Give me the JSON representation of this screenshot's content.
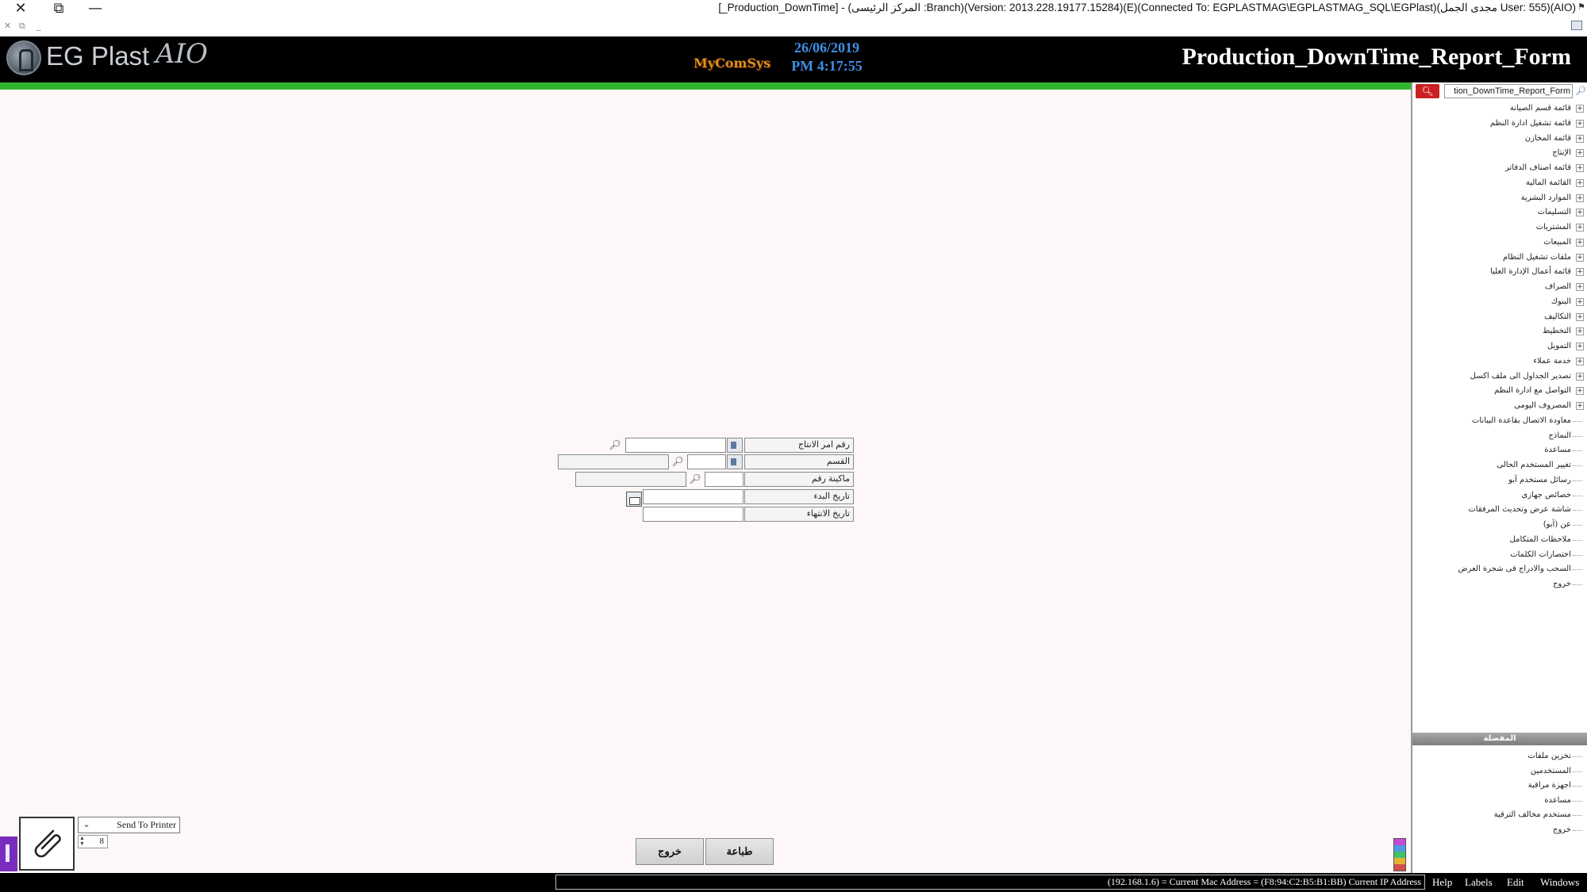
{
  "window": {
    "title": "[_Production_DownTime] - (المركز الرئيسى :Branch)(Version: 2013.228.19177.15284)(E)(Connected To: EGPLASTMAG\\EGPLASTMAG_SQL\\EGPlast)(مجدى الجمل User: 555)(AIO)",
    "close_glyph": "✕",
    "restore_glyph": "⧉",
    "minimize_glyph": "—"
  },
  "header": {
    "logo_text": "EG Plast",
    "logo_script": "AIO",
    "vendor": "MyComSys",
    "date": "26/06/2019",
    "time": "PM 4:17:55",
    "form_title": "Production_DownTime_Report_Form"
  },
  "form": {
    "fields": [
      {
        "label": "رقم امر الانتاج",
        "value": ""
      },
      {
        "label": "القسم",
        "value": ""
      },
      {
        "label": "ماكينة رقم",
        "value": ""
      },
      {
        "label": "تاريخ البدء",
        "value": ""
      },
      {
        "label": "تاريخ الانتهاء",
        "value": ""
      }
    ]
  },
  "print": {
    "destination": "Send To Printer",
    "copies": "8"
  },
  "buttons": {
    "print_label": "طباعة",
    "exit_label": "خروج"
  },
  "status": {
    "ip_text": "(192.168.1.6) = Current Mac Address = (F8:94:C2:B5:B1:BB) Current IP Address",
    "menu": [
      "Help",
      "Labels",
      "Edit",
      "Windows"
    ]
  },
  "tree": {
    "search_value": "tion_DownTime_Report_Form",
    "items": [
      {
        "label": "قائمة قسم الصيانة",
        "expandable": true
      },
      {
        "label": "قائمة تشغيل ادارة النظم",
        "expandable": true
      },
      {
        "label": "قائمة المخازن",
        "expandable": true
      },
      {
        "label": "الإنتاج",
        "expandable": true
      },
      {
        "label": "قائمة اصناف الدفاتر",
        "expandable": true
      },
      {
        "label": "القائمة المالية",
        "expandable": true
      },
      {
        "label": "الموارد البشرية",
        "expandable": true
      },
      {
        "label": "التسليمات",
        "expandable": true
      },
      {
        "label": "المشتريات",
        "expandable": true
      },
      {
        "label": "المبيعات",
        "expandable": true
      },
      {
        "label": "ملفات تشغيل النظام",
        "expandable": true
      },
      {
        "label": "قائمة أعمال الإدارة العليا",
        "expandable": true
      },
      {
        "label": "الصراف",
        "expandable": true
      },
      {
        "label": "البنوك",
        "expandable": true
      },
      {
        "label": "التكاليف",
        "expandable": true
      },
      {
        "label": "التخطيط",
        "expandable": true
      },
      {
        "label": "التمويل",
        "expandable": true
      },
      {
        "label": "خدمة عملاء",
        "expandable": true
      },
      {
        "label": "تصدير الجداول الى ملف اكسل",
        "expandable": true
      },
      {
        "label": "التواصل مع ادارة النظم",
        "expandable": true
      },
      {
        "label": "المصروف اليومى",
        "expandable": true
      },
      {
        "label": "معاودة الاتصال بقاعدة البيانات",
        "expandable": false
      },
      {
        "label": "النماذج",
        "expandable": false
      },
      {
        "label": "مساعدة",
        "expandable": false
      },
      {
        "label": "تغيير المستخدم الحالى",
        "expandable": false
      },
      {
        "label": "رسائل مستخدم آبو",
        "expandable": false
      },
      {
        "label": "خصائص جهازى",
        "expandable": false
      },
      {
        "label": "شاشة عرض وتحديث المرفقات",
        "expandable": false
      },
      {
        "label": "عن (آبو)",
        "expandable": false
      },
      {
        "label": "ملاحظات المتكامل",
        "expandable": false
      },
      {
        "label": "اختصارات الكلمات",
        "expandable": false
      },
      {
        "label": "السحب والادراج فى شجرة العرض",
        "expandable": false
      },
      {
        "label": "خروج",
        "expandable": false
      }
    ],
    "favorites_title": "المفضلة",
    "favorites": [
      {
        "label": "تخزين ملفات"
      },
      {
        "label": "المستخدمين"
      },
      {
        "label": "اجهزة مراقبة"
      },
      {
        "label": "مساعدة"
      },
      {
        "label": "مستخدم مخالف الترقية"
      },
      {
        "label": "خروج"
      }
    ]
  },
  "colors": {
    "accent_green": "#2fb52d",
    "header_bg": "#000000",
    "date_blue": "#3f8fe6",
    "search_red": "#cc1f1f"
  }
}
